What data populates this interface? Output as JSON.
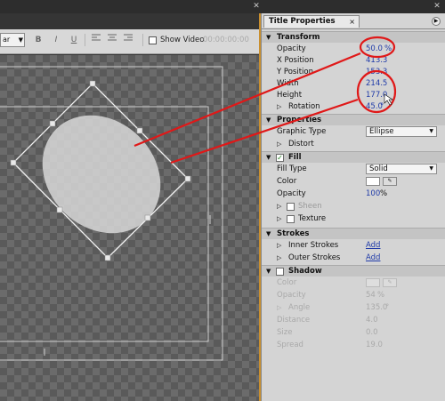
{
  "toolbar": {
    "font_select_value": "ar",
    "bold_icon": "B",
    "italic_icon": "I",
    "underline_icon": "U",
    "show_video_label": "Show Video",
    "show_video_time": "00:00:00:00"
  },
  "panel": {
    "title": "Title Properties",
    "close": "×",
    "menu_icon": "panel-menu-icon"
  },
  "sections": {
    "transform": "Transform",
    "properties": "Properties",
    "fill": "Fill",
    "strokes": "Strokes",
    "shadow": "Shadow"
  },
  "transform": {
    "opacity_label": "Opacity",
    "opacity_value": "50.0",
    "opacity_unit": "%",
    "xpos_label": "X Position",
    "xpos_value": "413.3",
    "ypos_label": "Y Position",
    "ypos_value": "153.3",
    "width_label": "Width",
    "width_value": "214.5",
    "height_label": "Height",
    "height_value": "177.0",
    "rotation_label": "Rotation",
    "rotation_value": "45.0",
    "rotation_unit": "°"
  },
  "properties": {
    "graphic_type_label": "Graphic Type",
    "graphic_type_value": "Ellipse",
    "distort_label": "Distort"
  },
  "fill": {
    "fill_type_label": "Fill Type",
    "fill_type_value": "Solid",
    "color_label": "Color",
    "opacity_label": "Opacity",
    "opacity_value": "100",
    "opacity_unit": "%",
    "sheen_label": "Sheen",
    "texture_label": "Texture"
  },
  "strokes": {
    "inner_label": "Inner Strokes",
    "inner_action": "Add",
    "outer_label": "Outer Strokes",
    "outer_action": "Add"
  },
  "shadow": {
    "color_label": "Color",
    "opacity_label": "Opacity",
    "opacity_value": "54",
    "opacity_unit": "%",
    "angle_label": "Angle",
    "angle_value": "135.0",
    "angle_unit": "°",
    "distance_label": "Distance",
    "distance_value": "4.0",
    "size_label": "Size",
    "size_value": "0.0",
    "spread_label": "Spread",
    "spread_value": "19.0"
  },
  "colors": {
    "accent_border": "#c98f2f",
    "annotation_red": "#e01818",
    "value_blue": "#1f3aa8"
  }
}
